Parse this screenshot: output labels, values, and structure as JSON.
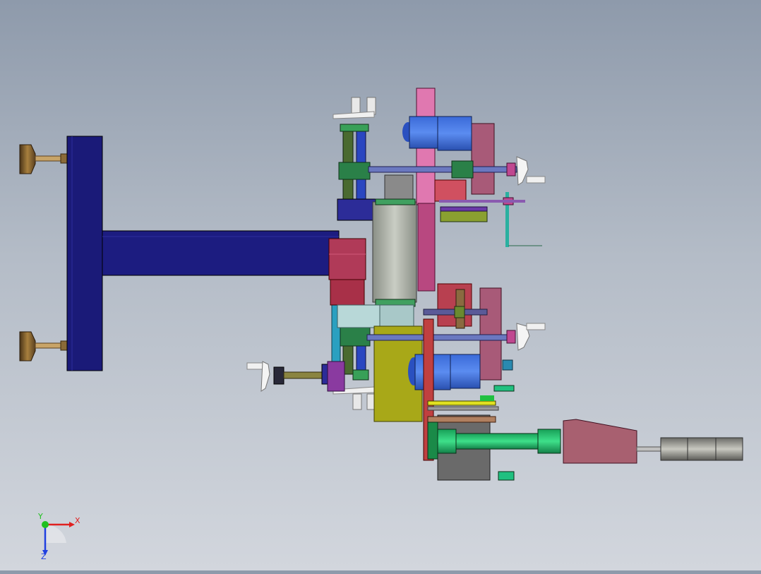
{
  "viewport": {
    "model": "cad-assembly-top-view"
  },
  "triad": {
    "x_label": "X",
    "y_label": "Y",
    "z_label": "Z",
    "colors": {
      "x": "#e02020",
      "y": "#20c020",
      "z": "#2040e0"
    }
  }
}
